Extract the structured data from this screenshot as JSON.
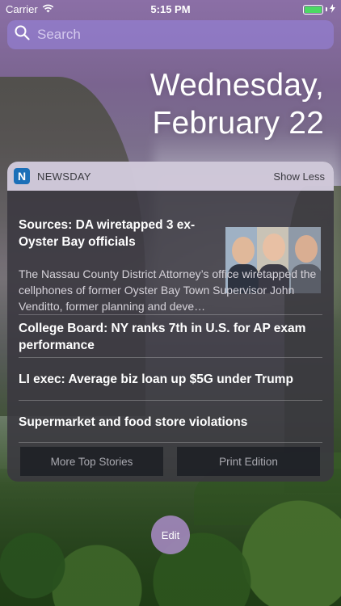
{
  "status_bar": {
    "carrier": "Carrier",
    "time": "5:15 PM",
    "battery_percent": 100
  },
  "search": {
    "placeholder": "Search"
  },
  "date": {
    "weekday": "Wednesday,",
    "month_day": "February 22"
  },
  "widget": {
    "app_icon_letter": "N",
    "app_name": "NEWSDAY",
    "show_less_label": "Show Less",
    "top_story": {
      "headline": "Sources: DA wiretapped 3 ex-Oyster Bay officials",
      "summary": "The Nassau County District Attorney’s office wiretapped the cellphones of former Oyster Bay Town Supervisor John Venditto, former planning and deve…"
    },
    "stories": [
      {
        "headline": "College Board: NY ranks 7th in U.S. for AP exam performance"
      },
      {
        "headline": "LI exec: Average biz loan up $5G under Trump"
      },
      {
        "headline": "Supermarket and food store violations"
      }
    ],
    "more_top_stories_label": "More Top Stories",
    "print_edition_label": "Print Edition"
  },
  "edit_label": "Edit",
  "colors": {
    "accent_app_icon": "#1b6fb8",
    "battery_fill": "#4cd964"
  }
}
